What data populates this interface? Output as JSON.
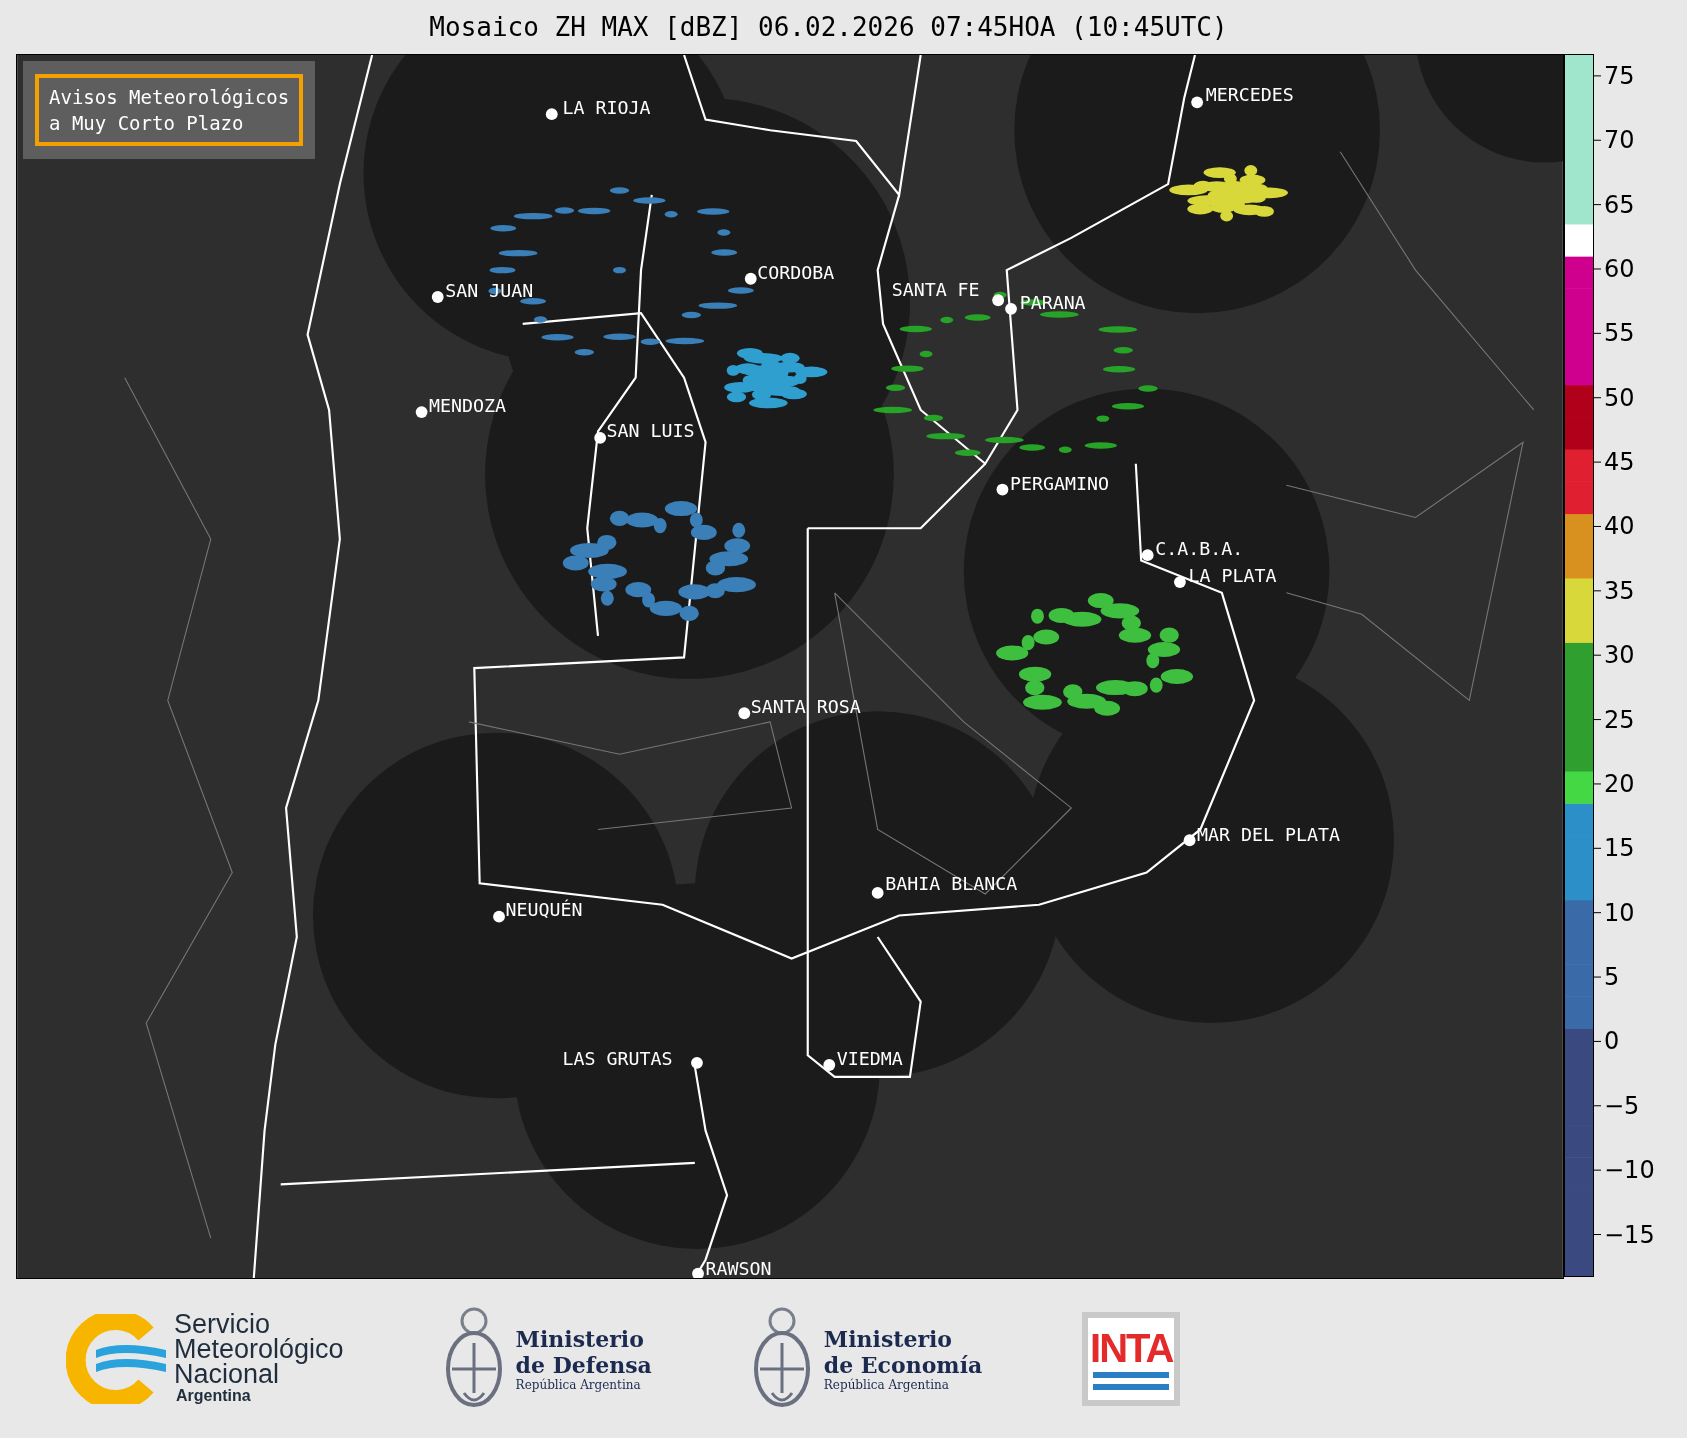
{
  "title": "Mosaico ZH MAX [dBZ] 06.02.2026 07:45HOA (10:45UTC)",
  "notice": {
    "lines": [
      "Avisos Meteorológicos",
      "a Muy Corto Plazo"
    ]
  },
  "cities": [
    {
      "name": "LA RIOJA"
    },
    {
      "name": "MERCEDES"
    },
    {
      "name": "CORDOBA"
    },
    {
      "name": "SAN JUAN"
    },
    {
      "name": "SANTA FE"
    },
    {
      "name": "PARANA"
    },
    {
      "name": "MENDOZA"
    },
    {
      "name": "SAN LUIS"
    },
    {
      "name": "PERGAMINO"
    },
    {
      "name": "C.A.B.A."
    },
    {
      "name": "LA PLATA"
    },
    {
      "name": "SANTA ROSA"
    },
    {
      "name": "MAR DEL PLATA"
    },
    {
      "name": "BAHIA BLANCA"
    },
    {
      "name": "NEUQUÉN"
    },
    {
      "name": "LAS GRUTAS"
    },
    {
      "name": "VIEDMA"
    },
    {
      "name": "RAWSON"
    }
  ],
  "colorbar": {
    "ticks": [
      "75",
      "70",
      "65",
      "60",
      "55",
      "50",
      "45",
      "40",
      "35",
      "30",
      "25",
      "20",
      "15",
      "10",
      "5",
      "0",
      "−5",
      "−10",
      "−15"
    ]
  },
  "footer": {
    "smn": {
      "lines": [
        "Servicio",
        "Meteorológico",
        "Nacional"
      ],
      "country": "Argentina"
    },
    "ministries": [
      {
        "lines": [
          "Ministerio",
          "de Defensa"
        ],
        "country": "República Argentina"
      },
      {
        "lines": [
          "Ministerio",
          "de Economía"
        ],
        "country": "República Argentina"
      }
    ],
    "inta": {
      "label": "INTA"
    }
  }
}
